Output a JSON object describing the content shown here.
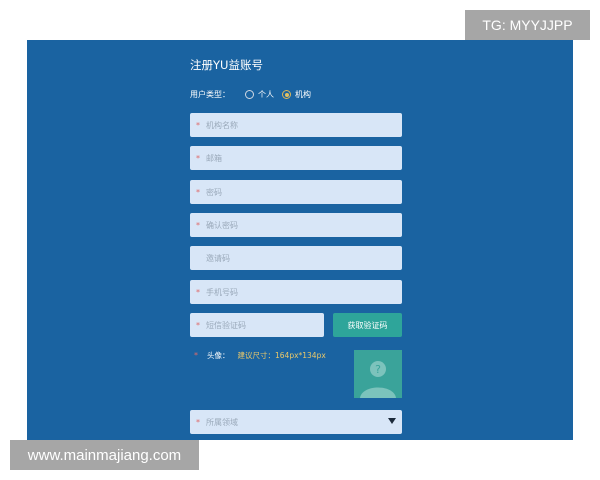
{
  "form": {
    "title": "注册YU益账号",
    "user_type": {
      "label": "用户类型：",
      "options": [
        {
          "label": "个人",
          "selected": false
        },
        {
          "label": "机构",
          "selected": true
        }
      ]
    },
    "fields": [
      {
        "placeholder": "机构名称",
        "required": true
      },
      {
        "placeholder": "邮箱",
        "required": true
      },
      {
        "placeholder": "密码",
        "required": true
      },
      {
        "placeholder": "确认密码",
        "required": true
      },
      {
        "placeholder": "邀请码",
        "required": false
      },
      {
        "placeholder": "手机号码",
        "required": true
      },
      {
        "placeholder": "短信验证码",
        "required": true
      }
    ],
    "get_code_button": "获取验证码",
    "avatar": {
      "label": "头像：",
      "hint": "建议尺寸：164px*134px",
      "placeholder_icon": "question-person-icon"
    },
    "region_select": {
      "placeholder": "所属领域"
    },
    "required_mark": "*"
  },
  "watermarks": {
    "top_right": "TG: MYYJJPP",
    "bottom_left": "www.mainmajiang.com"
  },
  "colors": {
    "panel_bg": "#1a63a1",
    "field_bg": "#d8e6f7",
    "button_bg": "#2ea59a",
    "avatar_bg": "#3aa39a",
    "hint_text": "#e9c86a",
    "required_mark": "#e06a6a"
  }
}
